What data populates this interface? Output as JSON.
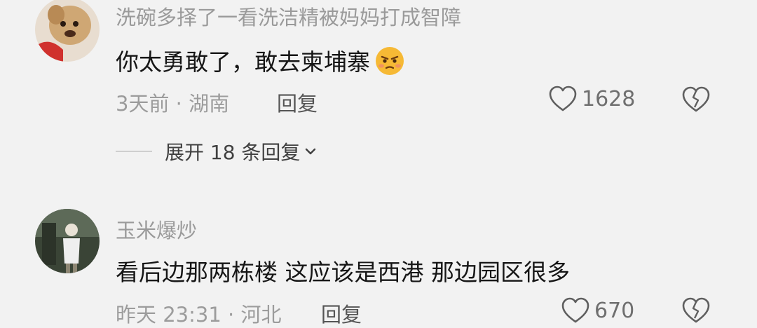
{
  "comments": [
    {
      "username": "洗碗多择了一看洗洁精被妈妈打成智障",
      "text": "你太勇敢了，敢去柬埔寨",
      "emoji": "annoyed-face-emoji",
      "time": "3天前",
      "location": "湖南",
      "reply_label": "回复",
      "likes": "1628"
    },
    {
      "username": "玉米爆炒",
      "text": "看后边那两栋楼 这应该是西港 那边园区很多",
      "time": "昨天 23:31",
      "location": "河北",
      "reply_label": "回复",
      "likes": "670"
    }
  ],
  "expand_replies": "展开 18 条回复",
  "colors": {
    "background": "#f2f2f2",
    "username": "#9a9a9a",
    "text": "#161616",
    "meta": "#9c9c9c"
  }
}
